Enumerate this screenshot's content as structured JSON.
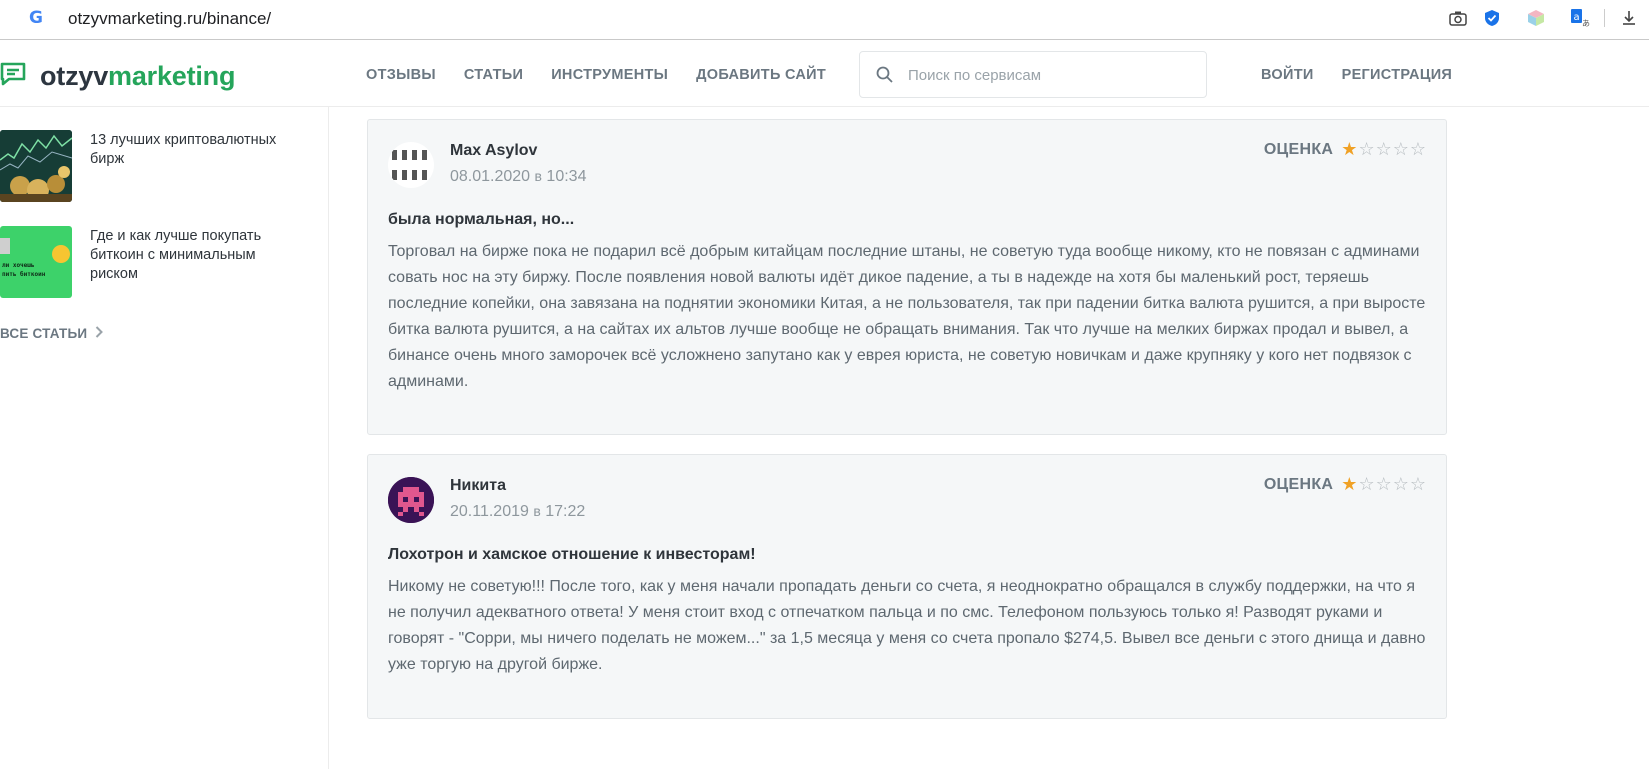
{
  "browser": {
    "url": "otzyvmarketing.ru/binance/",
    "g_letter": "G"
  },
  "header": {
    "logo_part1": "otzyv",
    "logo_part2": "marketing",
    "nav": [
      "ОТЗЫВЫ",
      "СТАТЬИ",
      "ИНСТРУМЕНТЫ",
      "ДОБАВИТЬ САЙТ"
    ],
    "search_placeholder": "Поиск по сервисам",
    "login": "ВОЙТИ",
    "register": "РЕГИСТРАЦИЯ"
  },
  "sidebar": {
    "items": [
      {
        "title": "13 лучших криптовалютных бирж"
      },
      {
        "title": "Где и как лучше покупать биткоин с минимальным риском",
        "thumb_text_1": "ли хочешь",
        "thumb_text_2": "пить биткоин"
      }
    ],
    "all_articles": "ВСЕ СТАТЬИ"
  },
  "reviews": [
    {
      "author": "Max Asylov",
      "date": "08.01.2020",
      "time_sep": "в",
      "time": "10:34",
      "rating_label": "ОЦЕНКА",
      "rating": 1,
      "rating_max": 5,
      "title": "была нормальная, но...",
      "body": "Торговал на бирже пока не подарил всё добрым китайцам последние штаны, не советую туда вообще никому, кто не повязан с админами совать нос на эту биржу. После появления новой валюты идёт дикое падение, а ты в надежде на хотя бы маленький рост, теряешь последние копейки, она завязана на поднятии экономики Китая, а не пользователя, так при падении битка валюта рушится, а при выросте битка валюта рушится, а на сайтах их альтов лучше вообще не обращать внимания. Так что лучше на мелких биржах продал и вывел, а бинансе очень много заморочек всё усложнено запутано как у еврея юриста, не советую новичкам и даже крупняку у кого нет подвязок с админами."
    },
    {
      "author": "Никита",
      "date": "20.11.2019",
      "time_sep": "в",
      "time": "17:22",
      "rating_label": "ОЦЕНКА",
      "rating": 1,
      "rating_max": 5,
      "title": "Лохотрон и хамское отношение к инвесторам!",
      "body": "Никому не советую!!! После того, как у меня начали пропадать деньги со счета, я неоднократно обращался в службу поддержки, на что я не получил адекватного ответа! У меня стоит вход с отпечатком пальца и по смс. Телефоном пользуюсь только я! Разводят руками и говорят - \"Сорри, мы ничего поделать не можем...\" за 1,5 месяца у меня со счета пропало $274,5. Вывел все деньги с этого днища и давно уже торгую на другой бирже."
    }
  ],
  "colors": {
    "brand_green": "#25a55b",
    "star_on": "#f0a125",
    "star_off": "#b6bcc0",
    "avatar2_bg": "#3a1356",
    "avatar2_fg": "#e0578e"
  }
}
